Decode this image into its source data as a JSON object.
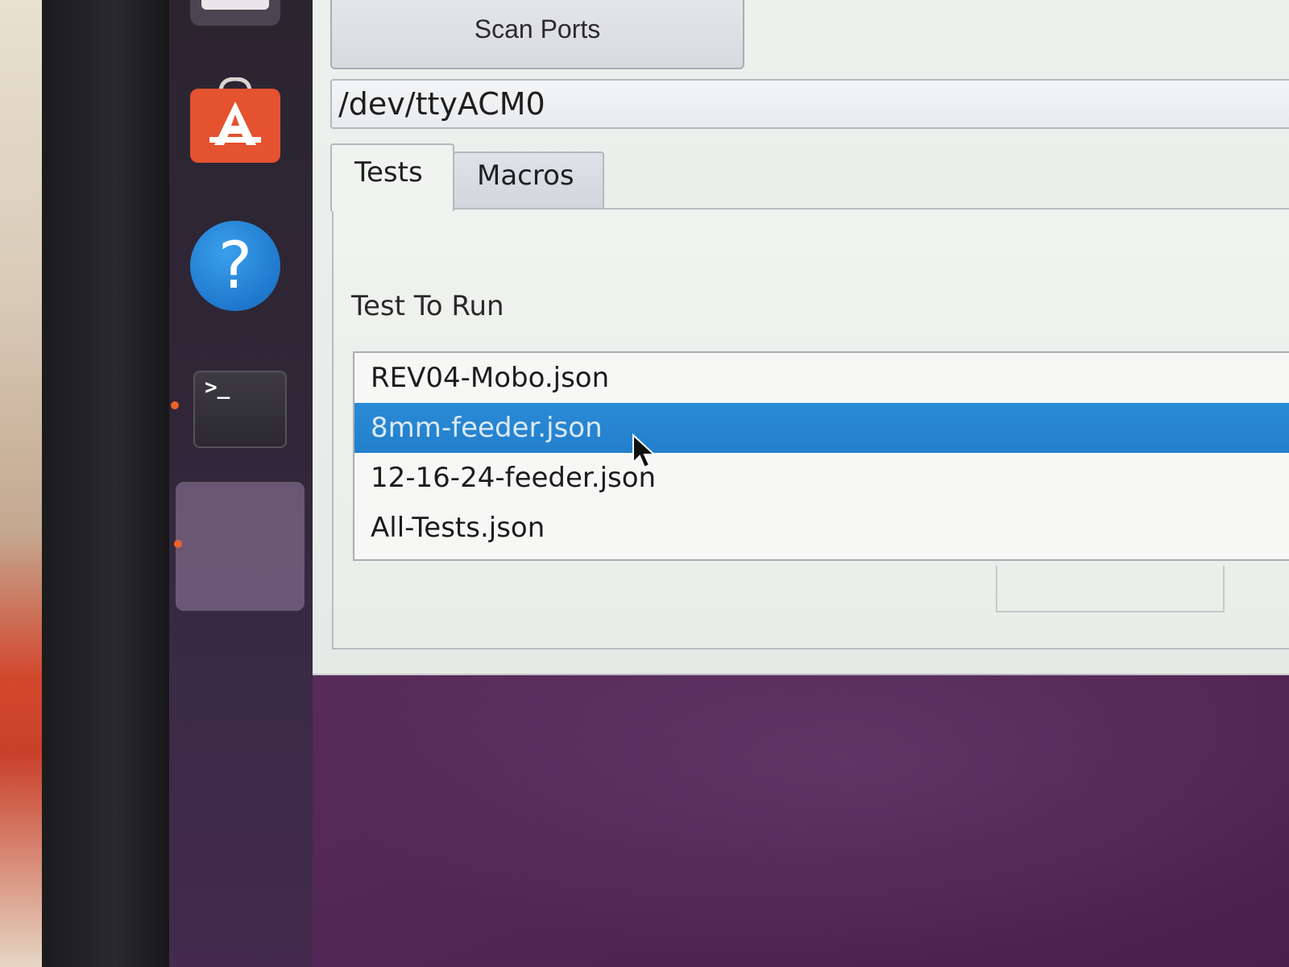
{
  "toolbar": {
    "scan_label": "Scan Ports"
  },
  "port": {
    "value": "/dev/ttyACM0"
  },
  "tabs": [
    {
      "label": "Tests",
      "active": true
    },
    {
      "label": "Macros",
      "active": false
    }
  ],
  "tests_panel": {
    "label": "Test To Run",
    "items": [
      {
        "label": "REV04-Mobo.json",
        "selected": false
      },
      {
        "label": "8mm-feeder.json",
        "selected": true
      },
      {
        "label": "12-16-24-feeder.json",
        "selected": false
      },
      {
        "label": "All-Tests.json",
        "selected": false
      }
    ]
  },
  "dock": {
    "items": [
      {
        "icon": "app-icon"
      },
      {
        "icon": "software-store-icon"
      },
      {
        "icon": "help-icon",
        "glyph": "?"
      },
      {
        "icon": "terminal-icon",
        "glyph": ">_"
      },
      {
        "icon": "running-app-icon"
      }
    ]
  },
  "colors": {
    "selection": "#237fcc",
    "dock_bg": "#2f2636",
    "desktop": "#5a2f5e",
    "running_indicator": "#e8622c",
    "software_orange": "#e4522f",
    "help_blue": "#1f78cc"
  }
}
